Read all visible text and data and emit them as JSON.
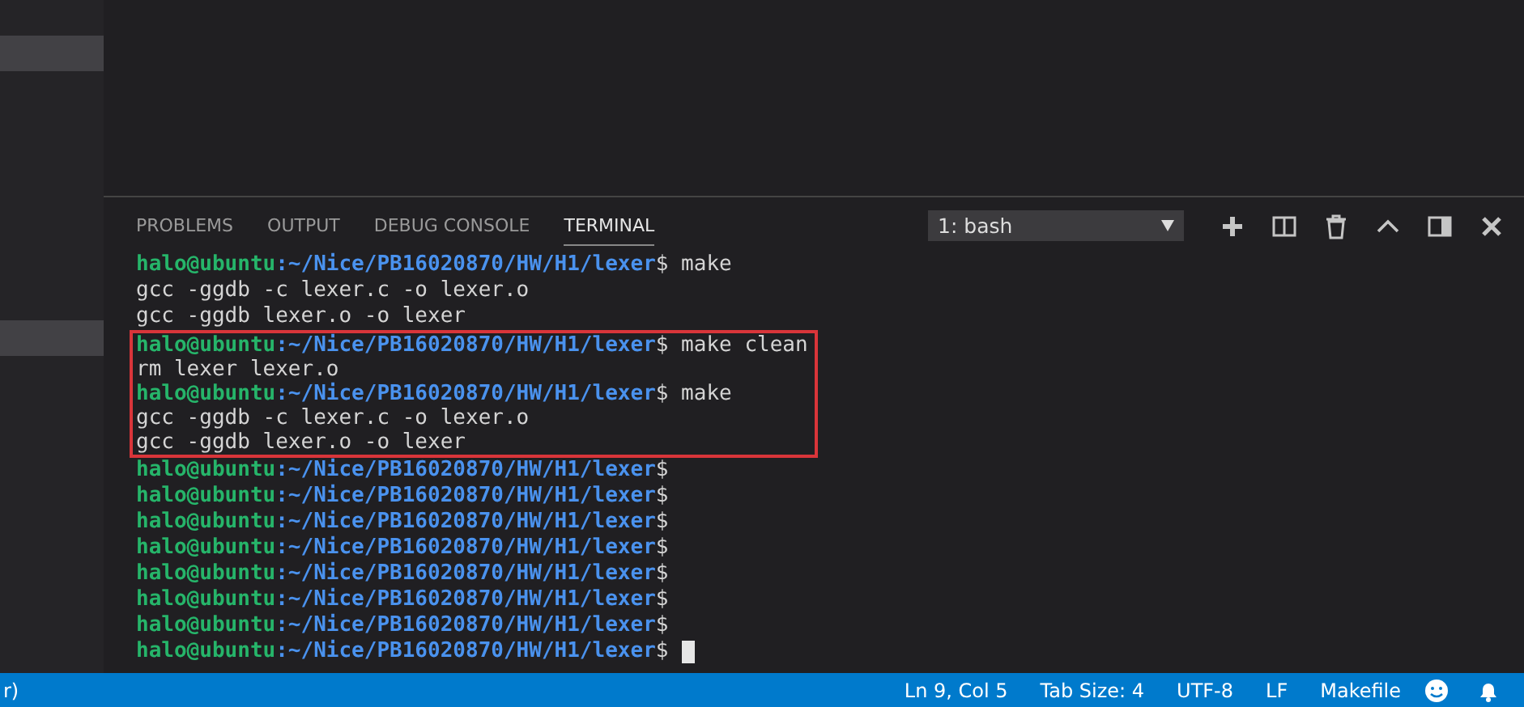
{
  "sidebar": {
    "items": [
      {
        "selected": false
      },
      {
        "selected": true
      },
      {
        "selected": false
      },
      {
        "selected": false
      },
      {
        "selected": false
      },
      {
        "selected": false
      },
      {
        "selected": false
      },
      {
        "selected": false
      },
      {
        "selected": false
      },
      {
        "selected": true
      },
      {
        "selected": false
      },
      {
        "selected": false
      },
      {
        "selected": false
      },
      {
        "selected": false
      },
      {
        "selected": false
      },
      {
        "selected": false
      },
      {
        "selected": false
      },
      {
        "selected": false
      }
    ]
  },
  "panel": {
    "tabs": [
      {
        "label": "PROBLEMS",
        "selected": false
      },
      {
        "label": "OUTPUT",
        "selected": false
      },
      {
        "label": "DEBUG CONSOLE",
        "selected": false
      },
      {
        "label": "TERMINAL",
        "selected": true
      }
    ],
    "terminal_select": {
      "value": "1: bash"
    },
    "terminal": {
      "blocks": [
        {
          "highlighted": false,
          "lines": [
            {
              "kind": "prompt",
              "user": "halo@ubuntu",
              "path": ":~/Nice/PB16020870/HW/H1/lexer",
              "command": "$ make"
            },
            {
              "kind": "output",
              "text": "gcc -ggdb -c lexer.c -o lexer.o"
            },
            {
              "kind": "output",
              "text": "gcc -ggdb lexer.o -o lexer"
            }
          ]
        },
        {
          "highlighted": true,
          "lines": [
            {
              "kind": "prompt",
              "user": "halo@ubuntu",
              "path": ":~/Nice/PB16020870/HW/H1/lexer",
              "command": "$ make clean"
            },
            {
              "kind": "output",
              "text": "rm lexer lexer.o"
            },
            {
              "kind": "prompt",
              "user": "halo@ubuntu",
              "path": ":~/Nice/PB16020870/HW/H1/lexer",
              "command": "$ make"
            },
            {
              "kind": "output",
              "text": "gcc -ggdb -c lexer.c -o lexer.o"
            },
            {
              "kind": "output",
              "text": "gcc -ggdb lexer.o -o lexer"
            }
          ]
        },
        {
          "highlighted": false,
          "lines": [
            {
              "kind": "prompt",
              "user": "halo@ubuntu",
              "path": ":~/Nice/PB16020870/HW/H1/lexer",
              "command": "$"
            },
            {
              "kind": "prompt",
              "user": "halo@ubuntu",
              "path": ":~/Nice/PB16020870/HW/H1/lexer",
              "command": "$"
            },
            {
              "kind": "prompt",
              "user": "halo@ubuntu",
              "path": ":~/Nice/PB16020870/HW/H1/lexer",
              "command": "$"
            },
            {
              "kind": "prompt",
              "user": "halo@ubuntu",
              "path": ":~/Nice/PB16020870/HW/H1/lexer",
              "command": "$"
            },
            {
              "kind": "prompt",
              "user": "halo@ubuntu",
              "path": ":~/Nice/PB16020870/HW/H1/lexer",
              "command": "$"
            },
            {
              "kind": "prompt",
              "user": "halo@ubuntu",
              "path": ":~/Nice/PB16020870/HW/H1/lexer",
              "command": "$"
            },
            {
              "kind": "prompt",
              "user": "halo@ubuntu",
              "path": ":~/Nice/PB16020870/HW/H1/lexer",
              "command": "$"
            },
            {
              "kind": "prompt",
              "user": "halo@ubuntu",
              "path": ":~/Nice/PB16020870/HW/H1/lexer",
              "command": "$",
              "cursor": true
            }
          ]
        }
      ]
    }
  },
  "status_bar": {
    "left": "r)",
    "items": [
      "Ln 9, Col 5",
      "Tab Size: 4",
      "UTF-8",
      "LF",
      "Makefile"
    ]
  }
}
